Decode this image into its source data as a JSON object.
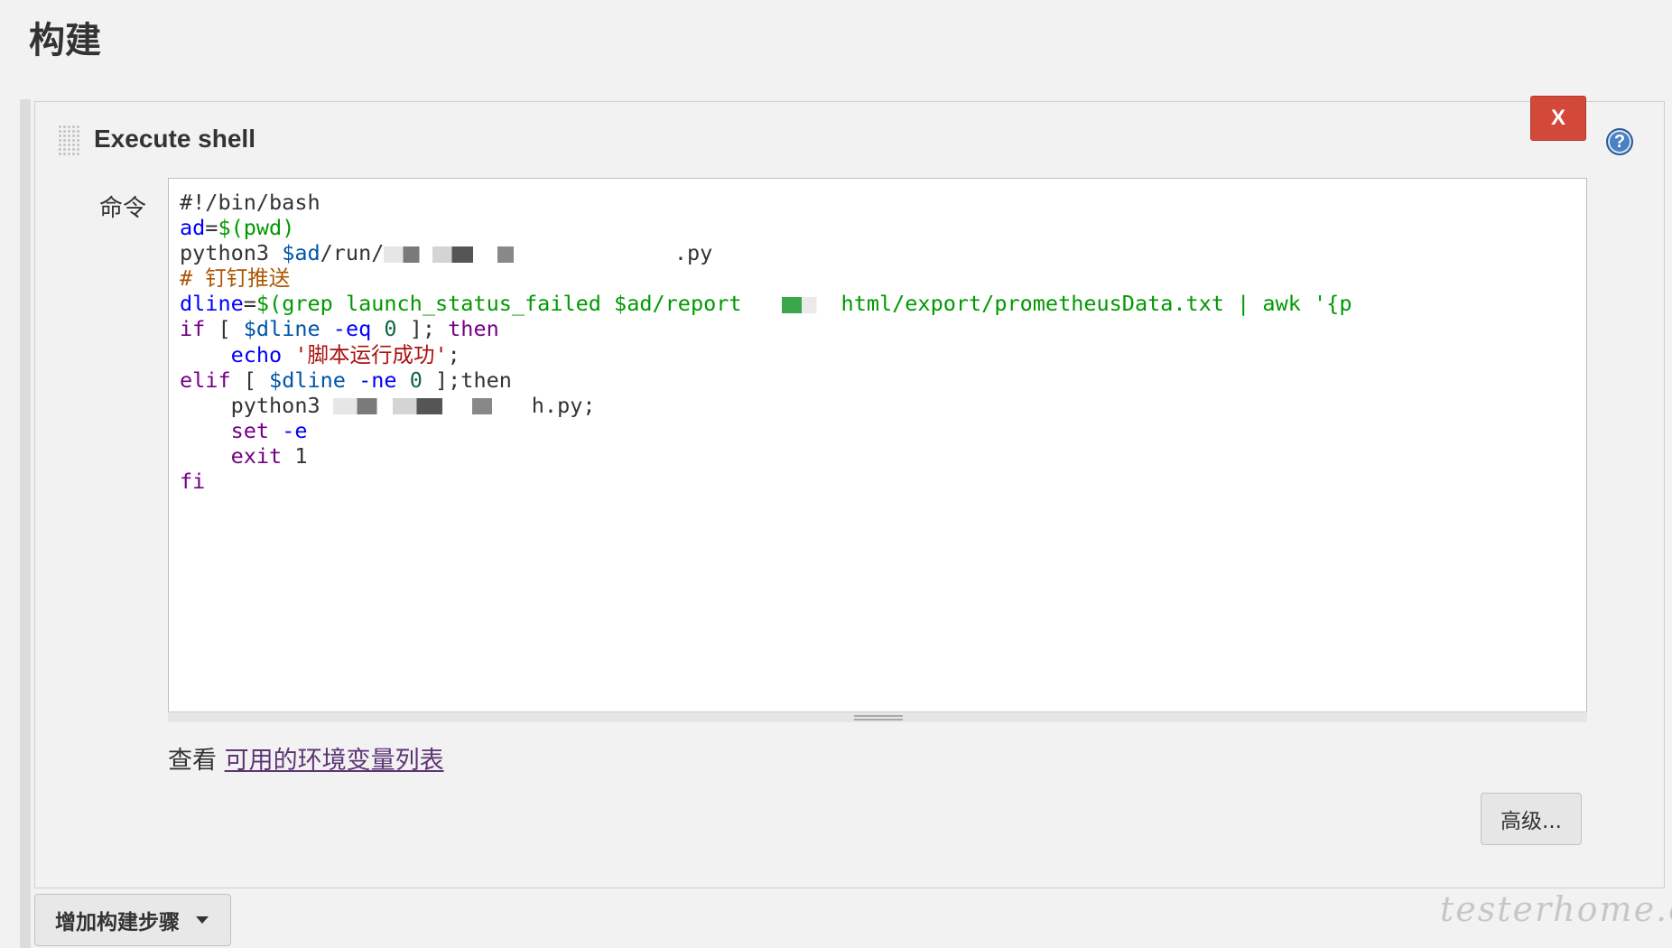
{
  "section": {
    "title": "构建"
  },
  "step": {
    "title": "Execute shell",
    "delete_label": "X",
    "help_label": "?"
  },
  "command": {
    "label": "命令",
    "lines": [
      [
        {
          "t": "#!/bin/bash",
          "c": "plain"
        }
      ],
      [
        {
          "t": "ad",
          "c": "def"
        },
        {
          "t": "=",
          "c": "plain"
        },
        {
          "t": "$(pwd)",
          "c": "fn"
        }
      ],
      [
        {
          "t": "python3 ",
          "c": "plain"
        },
        {
          "t": "$ad",
          "c": "var"
        },
        {
          "t": "/run/",
          "c": "plain"
        },
        {
          "t": "",
          "c": "redact",
          "w": 180
        },
        {
          "t": "          .py",
          "c": "plain"
        }
      ],
      [
        {
          "t": "# 钉钉推送",
          "c": "cm"
        }
      ],
      [
        {
          "t": "dline",
          "c": "def"
        },
        {
          "t": "=",
          "c": "plain"
        },
        {
          "t": "$(grep launch_status_failed $ad/report",
          "c": "fn"
        },
        {
          "t": "",
          "c": "redact",
          "w": 110
        },
        {
          "t": "html/export/prometheusData.txt | awk '{p",
          "c": "fn"
        }
      ],
      [
        {
          "t": "if",
          "c": "kw"
        },
        {
          "t": " [ ",
          "c": "plain"
        },
        {
          "t": "$dline",
          "c": "var"
        },
        {
          "t": " ",
          "c": "plain"
        },
        {
          "t": "-eq",
          "c": "def"
        },
        {
          "t": " ",
          "c": "plain"
        },
        {
          "t": "0",
          "c": "num"
        },
        {
          "t": " ]; ",
          "c": "plain"
        },
        {
          "t": "then",
          "c": "kw"
        }
      ],
      [
        {
          "t": "    ",
          "c": "plain"
        },
        {
          "t": "echo",
          "c": "def"
        },
        {
          "t": " ",
          "c": "plain"
        },
        {
          "t": "'脚本运行成功'",
          "c": "str"
        },
        {
          "t": ";",
          "c": "plain"
        }
      ],
      [
        {
          "t": "elif",
          "c": "kw"
        },
        {
          "t": " [ ",
          "c": "plain"
        },
        {
          "t": "$dline",
          "c": "var"
        },
        {
          "t": " ",
          "c": "plain"
        },
        {
          "t": "-ne",
          "c": "def"
        },
        {
          "t": " ",
          "c": "plain"
        },
        {
          "t": "0",
          "c": "num"
        },
        {
          "t": " ];then",
          "c": "plain"
        }
      ],
      [
        {
          "t": "    python3 ",
          "c": "plain"
        },
        {
          "t": "",
          "c": "redact",
          "w": 220
        },
        {
          "t": "h.py;",
          "c": "plain"
        }
      ],
      [
        {
          "t": "    ",
          "c": "plain"
        },
        {
          "t": "set",
          "c": "kw"
        },
        {
          "t": " ",
          "c": "plain"
        },
        {
          "t": "-e",
          "c": "def"
        }
      ],
      [
        {
          "t": "    ",
          "c": "plain"
        },
        {
          "t": "exit",
          "c": "kw"
        },
        {
          "t": " 1",
          "c": "plain"
        }
      ],
      [
        {
          "t": "fi",
          "c": "kw"
        }
      ]
    ]
  },
  "env": {
    "prefix": "查看 ",
    "link_label": "可用的环境变量列表"
  },
  "advanced_label": "高级...",
  "add_step_label": "增加构建步骤",
  "watermark": "testerhome.com"
}
